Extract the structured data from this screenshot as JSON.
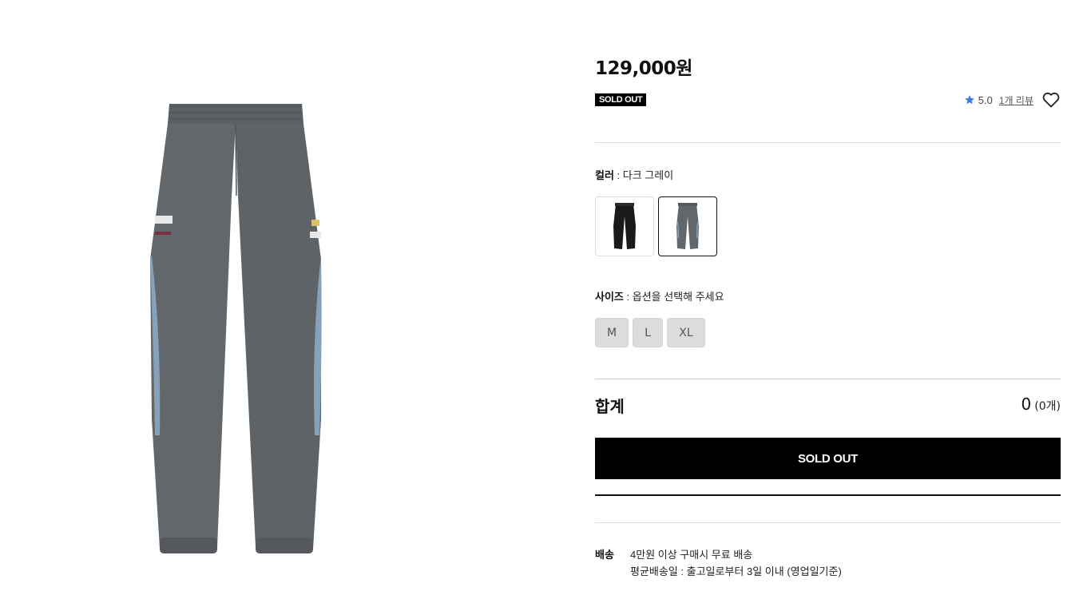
{
  "product": {
    "price": "129,000원",
    "status_badge": "SOLD OUT",
    "rating": "5.0",
    "review_link": "1개 리뷰"
  },
  "options": {
    "color_label": "컬러",
    "color_sep": " : ",
    "color_value": "다크 그레이",
    "size_label": "사이즈",
    "size_sep": " : ",
    "size_placeholder": "옵션을 선택해 주세요",
    "swatches": [
      {
        "name": "black",
        "selected": false
      },
      {
        "name": "dark-gray",
        "selected": true
      }
    ],
    "sizes": [
      "M",
      "L",
      "XL"
    ]
  },
  "total": {
    "label": "합계",
    "amount": "0",
    "count": "(0개)"
  },
  "action": {
    "button_label": "SOLD OUT"
  },
  "shipping": {
    "label": "배송",
    "line1": "4만원 이상 구매시 무료 배송",
    "line2": "평균배송일 : 출고일로부터 3일 이내 (영업일기준)"
  },
  "colors": {
    "accent_star": "#3d7be0",
    "badge_bg": "#000000",
    "pants_main": "#5f6468",
    "pants_panel": "#7f9cb5"
  }
}
